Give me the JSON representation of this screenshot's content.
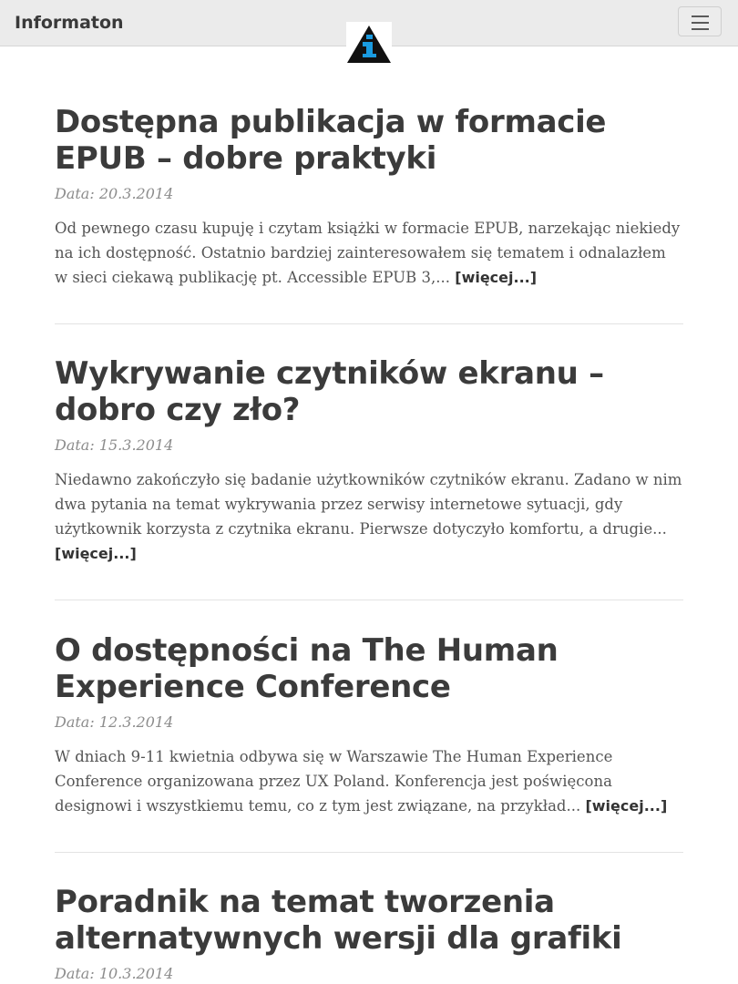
{
  "navbar": {
    "brand": "Informaton",
    "logo_icon": "information-triangle-icon",
    "menu_icon": "hamburger-icon"
  },
  "colors": {
    "navbar_bg": "#ebebeb",
    "heading": "#3b3b3b",
    "date": "#8c8c8c",
    "body_text": "#555555",
    "logo_accent": "#1a9be0"
  },
  "articles": [
    {
      "title": "Dostępna publikacja w formacie EPUB – dobre praktyki",
      "date": "Data: 20.3.2014",
      "excerpt": "Od pewnego czasu kupuję i czytam książki w formacie EPUB, narzekając niekiedy na ich dostępność. Ostatnio bardziej zainteresowałem się tematem i odnalazłem w sieci ciekawą publikację pt. Accessible EPUB 3,...",
      "more": "[więcej...]"
    },
    {
      "title": "Wykrywanie czytników ekranu – dobro czy zło?",
      "date": "Data: 15.3.2014",
      "excerpt": "Niedawno zakończyło się badanie użytkowników czytników ekranu. Zadano w nim dwa pytania na temat wykrywania przez serwisy internetowe sytuacji, gdy użytkownik korzysta z czytnika ekranu. Pierwsze dotyczyło komfortu, a drugie...",
      "more": "[więcej...]"
    },
    {
      "title": "O dostępności na The Human Experience Conference",
      "date": "Data: 12.3.2014",
      "excerpt": "W dniach 9-11 kwietnia odbywa się w Warszawie The Human Experience Conference organizowana przez UX Poland. Konferencja jest poświęcona designowi i wszystkiemu temu, co z tym jest związane, na przykład...",
      "more": "[więcej...]"
    },
    {
      "title": "Poradnik na temat tworzenia alternatywnych wersji dla grafiki",
      "date": "Data: 10.3.2014",
      "excerpt": "",
      "more": ""
    }
  ]
}
